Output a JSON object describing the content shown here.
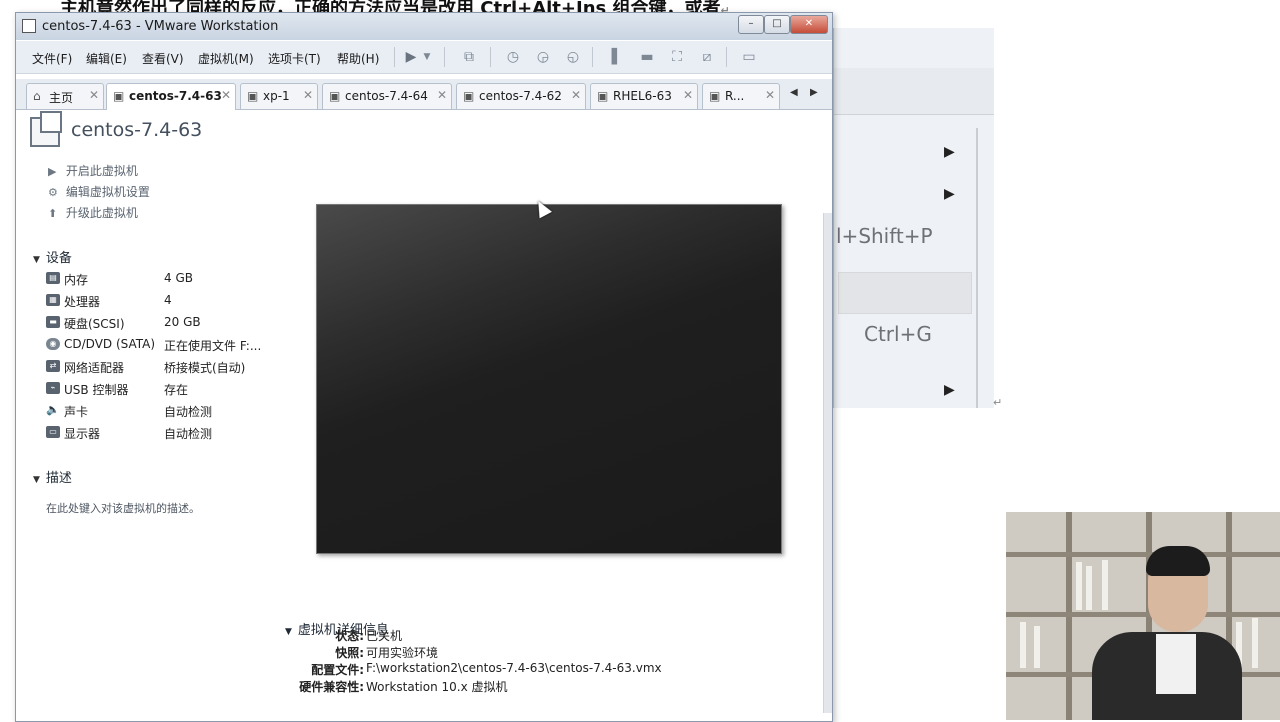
{
  "background": {
    "doc_heading": "主机竟然作出了同样的反应，正确的方法应当是改用 Ctrl+Alt+Ins 组合键，或者",
    "word_shortcuts": [
      "l+Shift+P",
      "Ctrl+G"
    ],
    "pilcrow": "↵"
  },
  "window": {
    "title": "centos-7.4-63 - VMware Workstation",
    "min_label": "–",
    "max_label": "□",
    "close_label": "✕"
  },
  "menu": {
    "file": "文件(F)",
    "edit": "编辑(E)",
    "view": "查看(V)",
    "vm": "虚拟机(M)",
    "tabs": "选项卡(T)",
    "help": "帮助(H)"
  },
  "tabs": [
    {
      "label": "主页",
      "icon": "home-icon",
      "close": "✕"
    },
    {
      "label": "centos-7.4-63",
      "icon": "vm-icon",
      "close": "✕"
    },
    {
      "label": "xp-1",
      "icon": "vm-icon",
      "close": "✕"
    },
    {
      "label": "centos-7.4-64",
      "icon": "vm-icon",
      "close": "✕"
    },
    {
      "label": "centos-7.4-62",
      "icon": "vm-icon",
      "close": "✕"
    },
    {
      "label": "RHEL6-63",
      "icon": "vm-icon",
      "close": "✕"
    },
    {
      "label": "R...",
      "icon": "vm-icon",
      "close": "✕"
    }
  ],
  "vm": {
    "name": "centos-7.4-63",
    "actions": [
      {
        "label": "开启此虚拟机",
        "icon": "play-icon"
      },
      {
        "label": "编辑虚拟机设置",
        "icon": "settings-icon"
      },
      {
        "label": "升级此虚拟机",
        "icon": "upgrade-icon"
      }
    ],
    "devices_header": "设备",
    "devices": [
      {
        "name": "内存",
        "value": "4 GB",
        "icon": "memory-icon"
      },
      {
        "name": "处理器",
        "value": "4",
        "icon": "cpu-icon"
      },
      {
        "name": "硬盘(SCSI)",
        "value": "20 GB",
        "icon": "harddisk-icon"
      },
      {
        "name": "CD/DVD (SATA)",
        "value": "正在使用文件 F:...",
        "icon": "cdrom-icon"
      },
      {
        "name": "网络适配器",
        "value": "桥接模式(自动)",
        "icon": "network-icon"
      },
      {
        "name": "USB 控制器",
        "value": "存在",
        "icon": "usb-icon"
      },
      {
        "name": "声卡",
        "value": "自动检测",
        "icon": "sound-icon"
      },
      {
        "name": "显示器",
        "value": "自动检测",
        "icon": "display-icon"
      }
    ],
    "description_header": "描述",
    "description_placeholder": "在此处键入对该虚拟机的描述。",
    "details_header": "虚拟机详细信息",
    "details": [
      {
        "label": "状态:",
        "value": "已关机"
      },
      {
        "label": "快照:",
        "value": "可用实验环境"
      },
      {
        "label": "配置文件:",
        "value": "F:\\workstation2\\centos-7.4-63\\centos-7.4-63.vmx"
      },
      {
        "label": "硬件兼容性:",
        "value": "Workstation 10.x 虚拟机"
      }
    ]
  }
}
